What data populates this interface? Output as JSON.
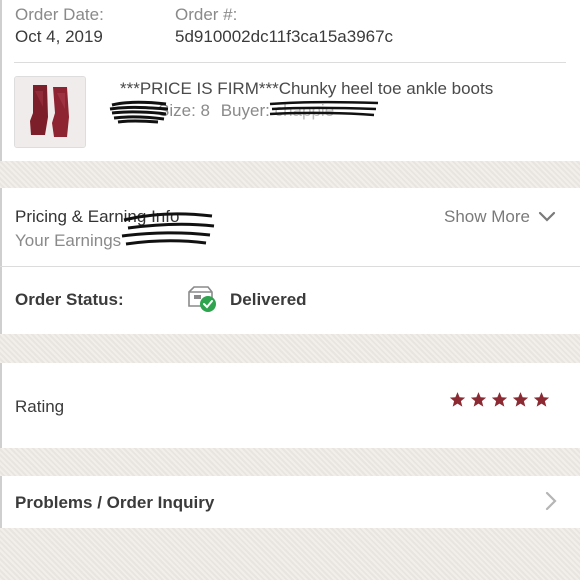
{
  "order": {
    "date_label": "Order Date:",
    "date_value": "Oct 4, 2019",
    "number_label": "Order #:",
    "number_value": "5d910002dc11f3ca15a3967c"
  },
  "item": {
    "title": "***PRICE IS FIRM***Chunky heel toe ankle boots",
    "size_text": "Size: 8",
    "buyer_label": "Buyer:",
    "buyer_value": "chappie"
  },
  "pricing": {
    "title": "Pricing & Earning Info",
    "earnings_label": "Your Earnings",
    "show_more_label": "Show More"
  },
  "status": {
    "label": "Order Status:",
    "value": "Delivered",
    "icon": "delivered-box-icon",
    "icon_color": "#2ea44f"
  },
  "rating": {
    "label": "Rating",
    "stars": 5,
    "star_color": "#8b2a32"
  },
  "problems": {
    "label": "Problems / Order Inquiry"
  }
}
